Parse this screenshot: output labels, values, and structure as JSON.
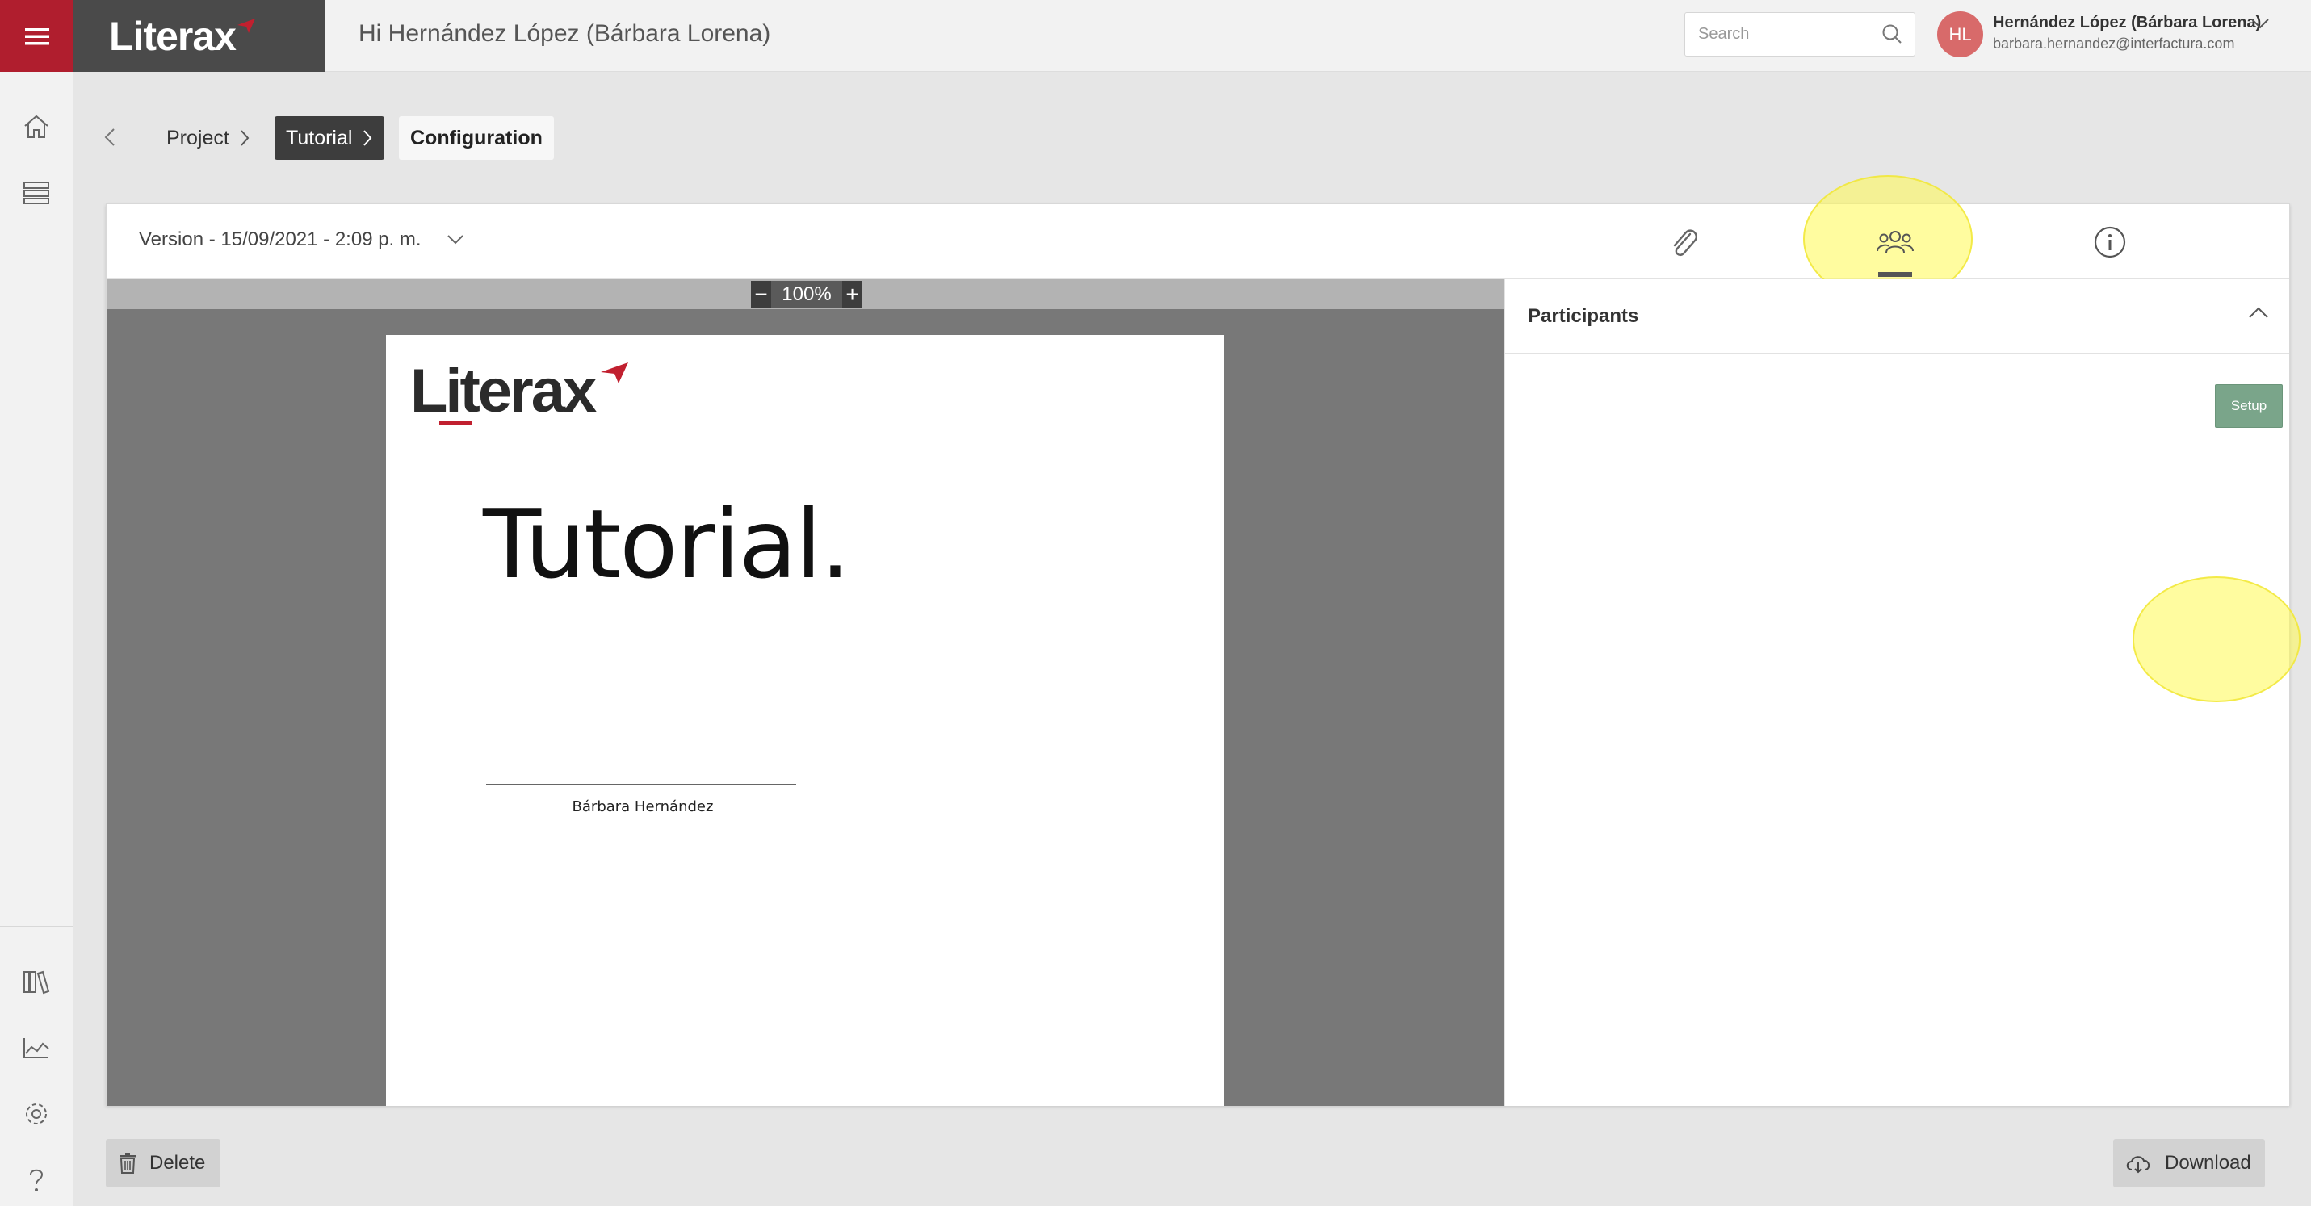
{
  "header": {
    "brand": "Literax",
    "greeting": "Hi Hernández López (Bárbara Lorena)",
    "search_placeholder": "Search",
    "avatar_initials": "HL",
    "user_name": "Hernández López (Bárbara Lorena)",
    "user_email": "barbara.hernandez@interfactura.com"
  },
  "breadcrumb": {
    "items": [
      {
        "label": "Project"
      },
      {
        "label": "Tutorial"
      },
      {
        "label": "Configuration"
      }
    ]
  },
  "card": {
    "version_label": "Version - 15/09/2021 - 2:09 p. m.",
    "tabs": [
      "paperclip-icon",
      "participants-icon",
      "info-icon"
    ],
    "active_tab": "participants-icon"
  },
  "viewer": {
    "zoom": "100%",
    "zoom_minus": "−",
    "zoom_plus": "+",
    "doc_logo": "Literax",
    "doc_title": "Tutorial.",
    "signer_name": "Bárbara Hernández"
  },
  "panel": {
    "title": "Participants",
    "setup_label": "Setup"
  },
  "footer": {
    "delete_label": "Delete",
    "download_label": "Download"
  },
  "colors": {
    "brand_red": "#b01e2e",
    "dark": "#3d3d3d",
    "setup_green": "#7aa58a",
    "highlight": "#fff950"
  }
}
